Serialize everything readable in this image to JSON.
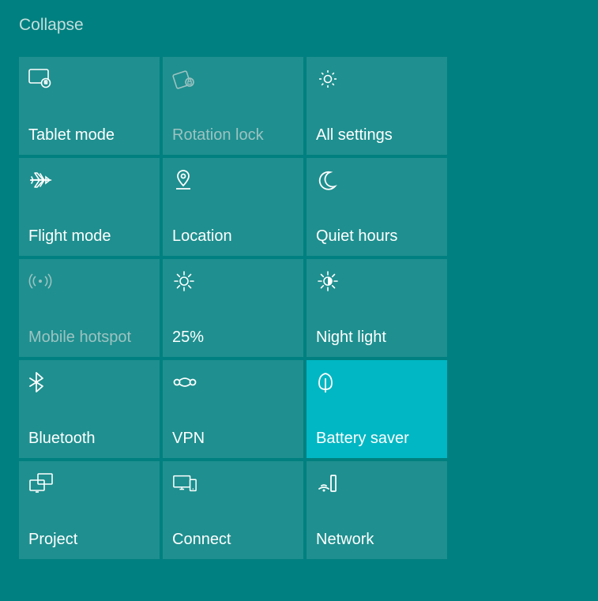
{
  "header": {
    "collapse_label": "Collapse"
  },
  "tiles": [
    {
      "label": "Tablet mode",
      "state": "normal"
    },
    {
      "label": "Rotation lock",
      "state": "disabled"
    },
    {
      "label": "All settings",
      "state": "normal"
    },
    {
      "label": "Flight mode",
      "state": "normal"
    },
    {
      "label": "Location",
      "state": "normal"
    },
    {
      "label": "Quiet hours",
      "state": "normal"
    },
    {
      "label": "Mobile hotspot",
      "state": "disabled"
    },
    {
      "label": "25%",
      "state": "normal"
    },
    {
      "label": "Night light",
      "state": "normal"
    },
    {
      "label": "Bluetooth",
      "state": "normal"
    },
    {
      "label": "VPN",
      "state": "normal"
    },
    {
      "label": "Battery saver",
      "state": "active"
    },
    {
      "label": "Project",
      "state": "normal"
    },
    {
      "label": "Connect",
      "state": "normal"
    },
    {
      "label": "Network",
      "state": "normal"
    }
  ],
  "colors": {
    "background": "#008080",
    "tile_bg": "rgba(255,255,255,0.12)",
    "tile_active": "#00b7c3",
    "disabled_text": "#9cc3c2"
  }
}
